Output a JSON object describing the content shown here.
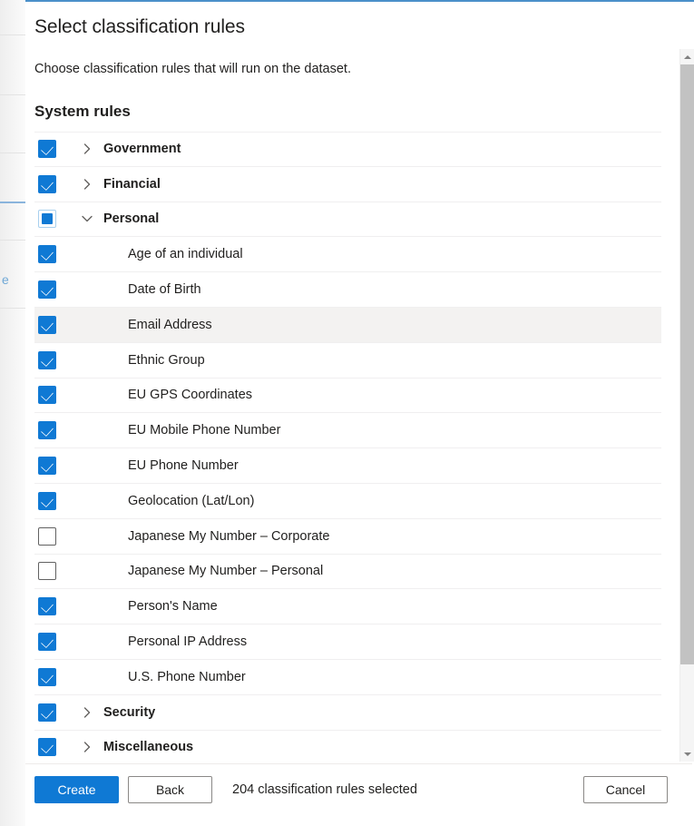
{
  "panel": {
    "title": "Select classification rules",
    "subtitle": "Choose classification rules that will run on the dataset.",
    "section_heading": "System rules",
    "accent_color": "#0f79d4",
    "top_border_color": "#4a90c9"
  },
  "background_page": {
    "link_fragment": "e"
  },
  "rules": [
    {
      "label": "Government",
      "type": "group",
      "state": "checked",
      "expanded": false,
      "highlighted": false
    },
    {
      "label": "Financial",
      "type": "group",
      "state": "checked",
      "expanded": false,
      "highlighted": false
    },
    {
      "label": "Personal",
      "type": "group",
      "state": "indeterminate",
      "expanded": true,
      "highlighted": false
    },
    {
      "label": "Age of an individual",
      "type": "child",
      "state": "checked",
      "expanded": null,
      "highlighted": false
    },
    {
      "label": "Date of Birth",
      "type": "child",
      "state": "checked",
      "expanded": null,
      "highlighted": false
    },
    {
      "label": "Email Address",
      "type": "child",
      "state": "checked",
      "expanded": null,
      "highlighted": true
    },
    {
      "label": "Ethnic Group",
      "type": "child",
      "state": "checked",
      "expanded": null,
      "highlighted": false
    },
    {
      "label": "EU GPS Coordinates",
      "type": "child",
      "state": "checked",
      "expanded": null,
      "highlighted": false
    },
    {
      "label": "EU Mobile Phone Number",
      "type": "child",
      "state": "checked",
      "expanded": null,
      "highlighted": false
    },
    {
      "label": "EU Phone Number",
      "type": "child",
      "state": "checked",
      "expanded": null,
      "highlighted": false
    },
    {
      "label": "Geolocation (Lat/Lon)",
      "type": "child",
      "state": "checked",
      "expanded": null,
      "highlighted": false
    },
    {
      "label": "Japanese My Number – Corporate",
      "type": "child",
      "state": "unchecked",
      "expanded": null,
      "highlighted": false
    },
    {
      "label": "Japanese My Number – Personal",
      "type": "child",
      "state": "unchecked",
      "expanded": null,
      "highlighted": false
    },
    {
      "label": "Person's Name",
      "type": "child",
      "state": "checked",
      "expanded": null,
      "highlighted": false
    },
    {
      "label": "Personal IP Address",
      "type": "child",
      "state": "checked",
      "expanded": null,
      "highlighted": false
    },
    {
      "label": "U.S. Phone Number",
      "type": "child",
      "state": "checked",
      "expanded": null,
      "highlighted": false
    },
    {
      "label": "Security",
      "type": "group",
      "state": "checked",
      "expanded": false,
      "highlighted": false
    },
    {
      "label": "Miscellaneous",
      "type": "group",
      "state": "checked",
      "expanded": false,
      "highlighted": false
    }
  ],
  "scrollbar": {
    "up_arrow": "scroll-up-arrow",
    "down_arrow": "scroll-down-arrow"
  },
  "footer": {
    "create_label": "Create",
    "back_label": "Back",
    "cancel_label": "Cancel",
    "status_text": "204 classification rules selected"
  }
}
